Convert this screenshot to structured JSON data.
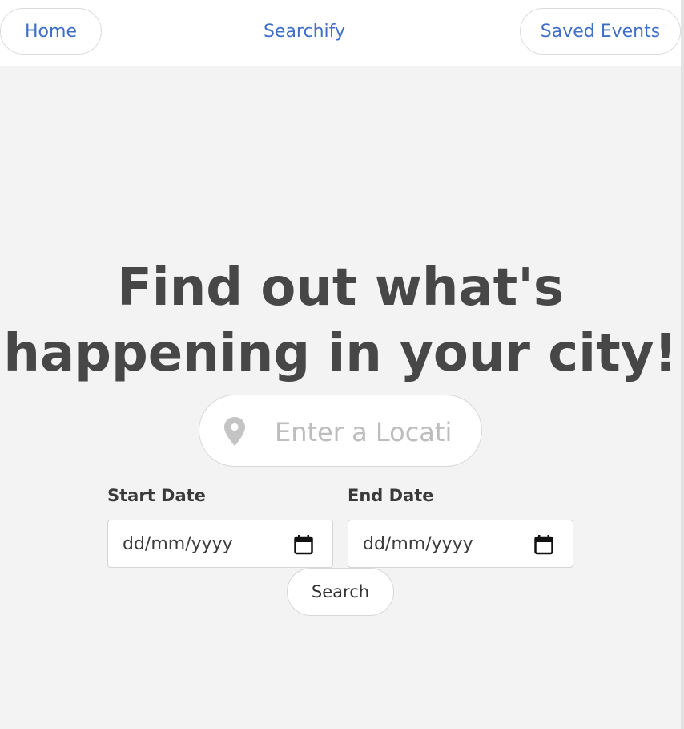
{
  "navbar": {
    "home_label": "Home",
    "brand_label": "Searchify",
    "saved_label": "Saved Events"
  },
  "hero": {
    "headline": "Find out what's happening in your city!"
  },
  "location": {
    "placeholder": "Enter a Location",
    "icon": "map-pin-icon"
  },
  "dates": {
    "start_label": "Start Date",
    "start_value": "dd/mm/yyyy",
    "end_label": "End Date",
    "end_value": "dd/mm/yyyy",
    "icon": "calendar-icon"
  },
  "search": {
    "button_label": "Search"
  },
  "colors": {
    "accent": "#3f6fc8",
    "background": "#f3f3f3",
    "headline": "#474747"
  }
}
